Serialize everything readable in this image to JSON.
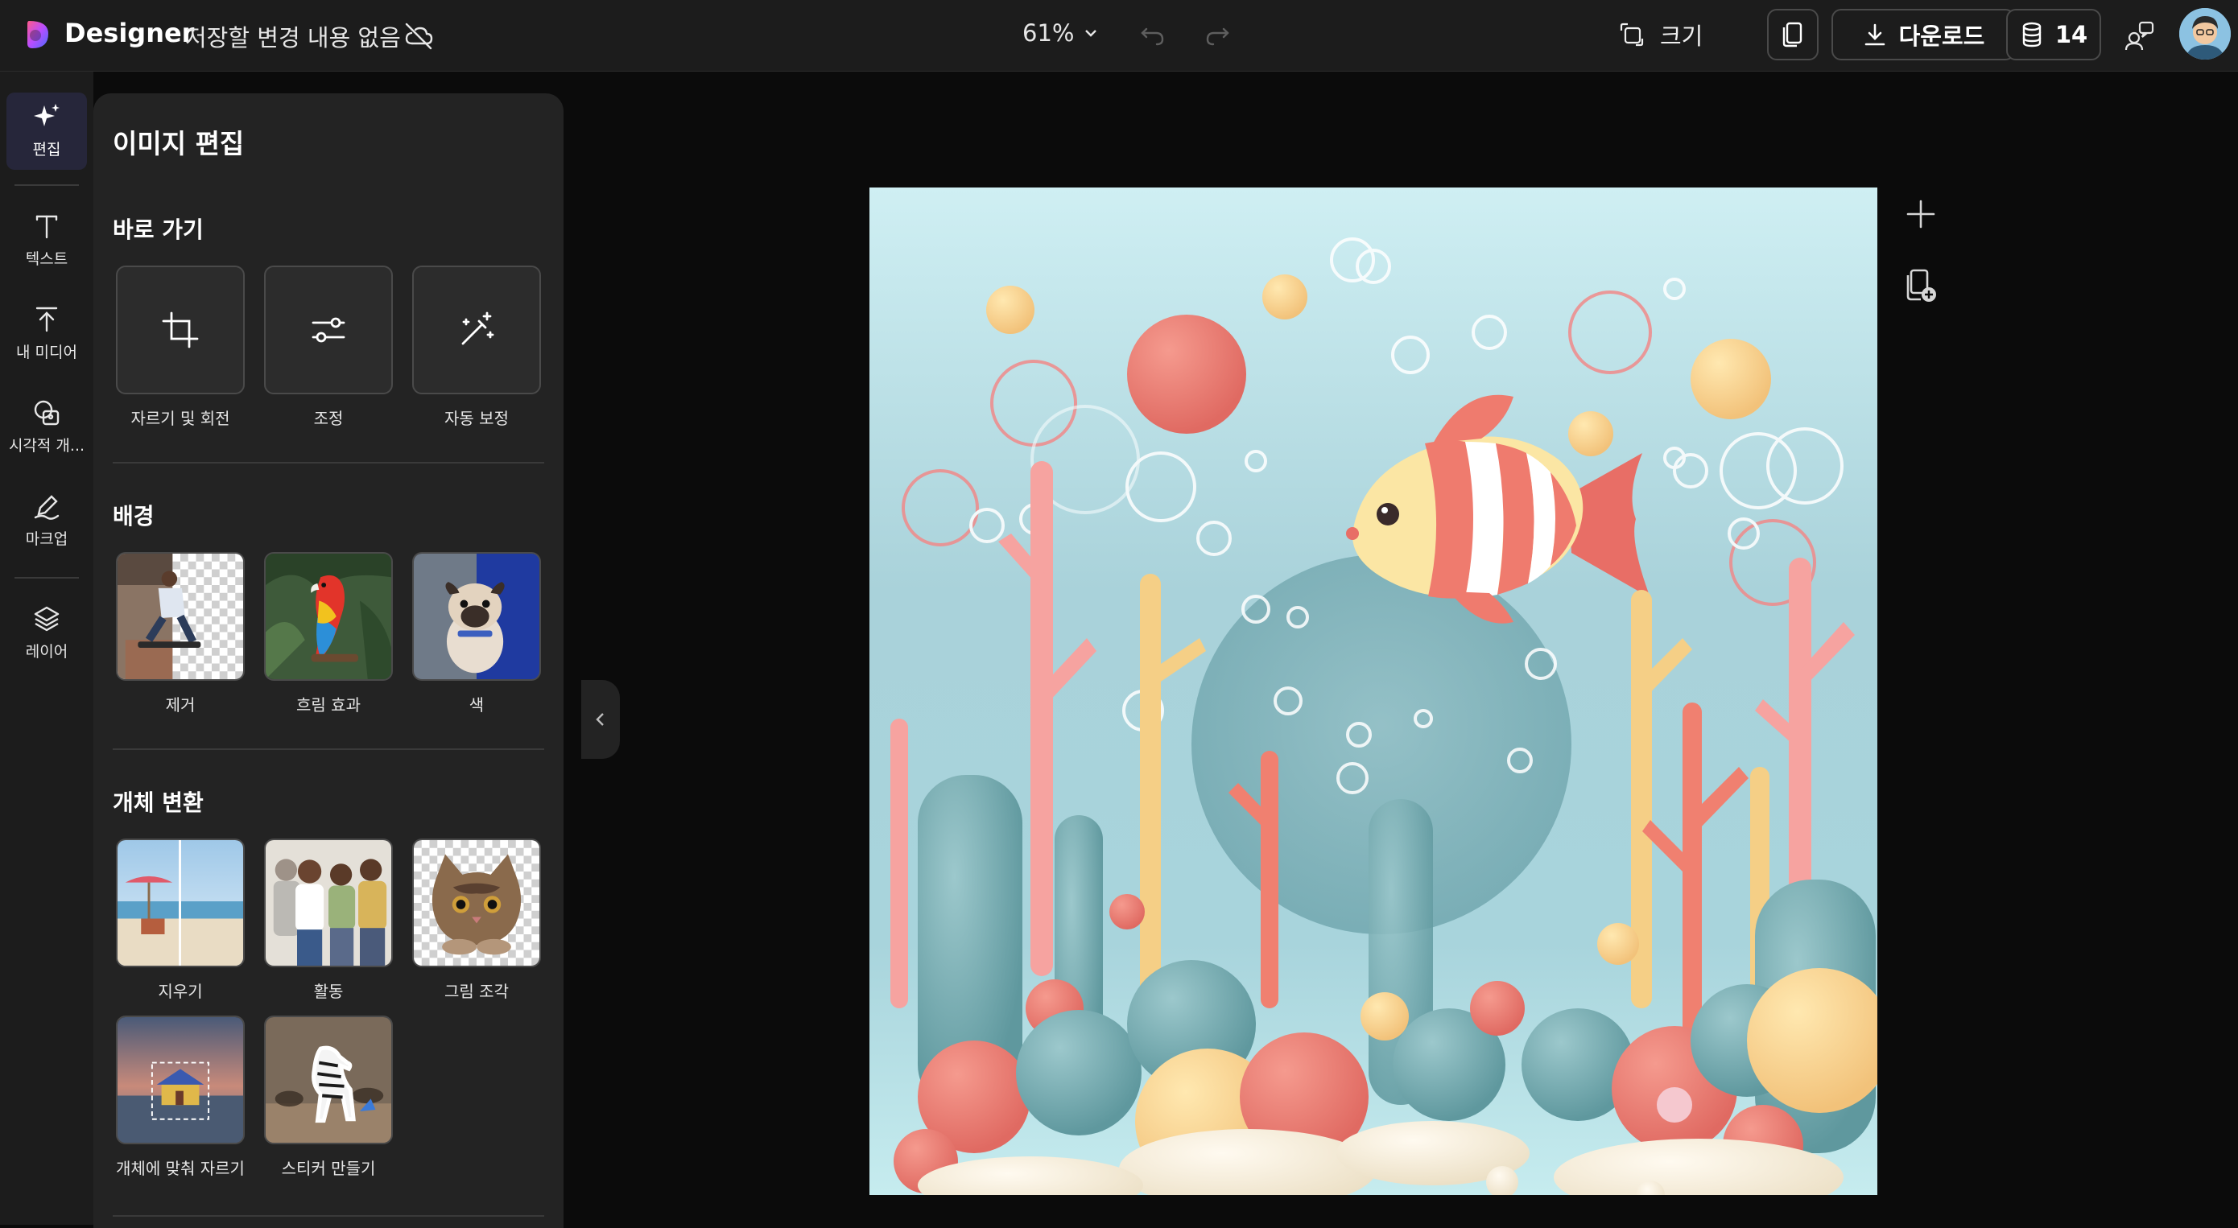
{
  "header": {
    "brand": "Designer",
    "save_status": "저장할 변경 내용 없음",
    "zoom": "61%",
    "resize_label": "크기",
    "download_label": "다운로드",
    "credits": "14"
  },
  "rail": {
    "items": [
      {
        "label": "편집",
        "icon": "sparkle-icon",
        "active": true
      },
      {
        "label": "텍스트",
        "icon": "text-icon"
      },
      {
        "label": "내 미디어",
        "icon": "upload-icon"
      },
      {
        "label": "시각적 개...",
        "icon": "visuals-icon"
      },
      {
        "label": "마크업",
        "icon": "pen-icon"
      },
      {
        "label": "레이어",
        "icon": "layers-icon"
      }
    ]
  },
  "panel": {
    "title": "이미지 편집",
    "shortcuts": {
      "title": "바로 가기",
      "items": [
        {
          "label": "자르기 및 회전",
          "icon": "crop-icon"
        },
        {
          "label": "조정",
          "icon": "sliders-icon"
        },
        {
          "label": "자동 보정",
          "icon": "magic-wand-icon"
        }
      ]
    },
    "background": {
      "title": "배경",
      "items": [
        {
          "label": "제거"
        },
        {
          "label": "흐림 효과"
        },
        {
          "label": "색"
        }
      ]
    },
    "object": {
      "title": "개체 변환",
      "items": [
        {
          "label": "지우기"
        },
        {
          "label": "활동"
        },
        {
          "label": "그림 조각"
        },
        {
          "label": "개체에 맞춰 자르기"
        },
        {
          "label": "스티커 만들기"
        }
      ]
    }
  },
  "colors": {
    "topbar_bg": "#1c1c1c",
    "panel_bg": "#232323",
    "workspace_bg": "#0b0b0b",
    "rail_active": "#26263a"
  }
}
